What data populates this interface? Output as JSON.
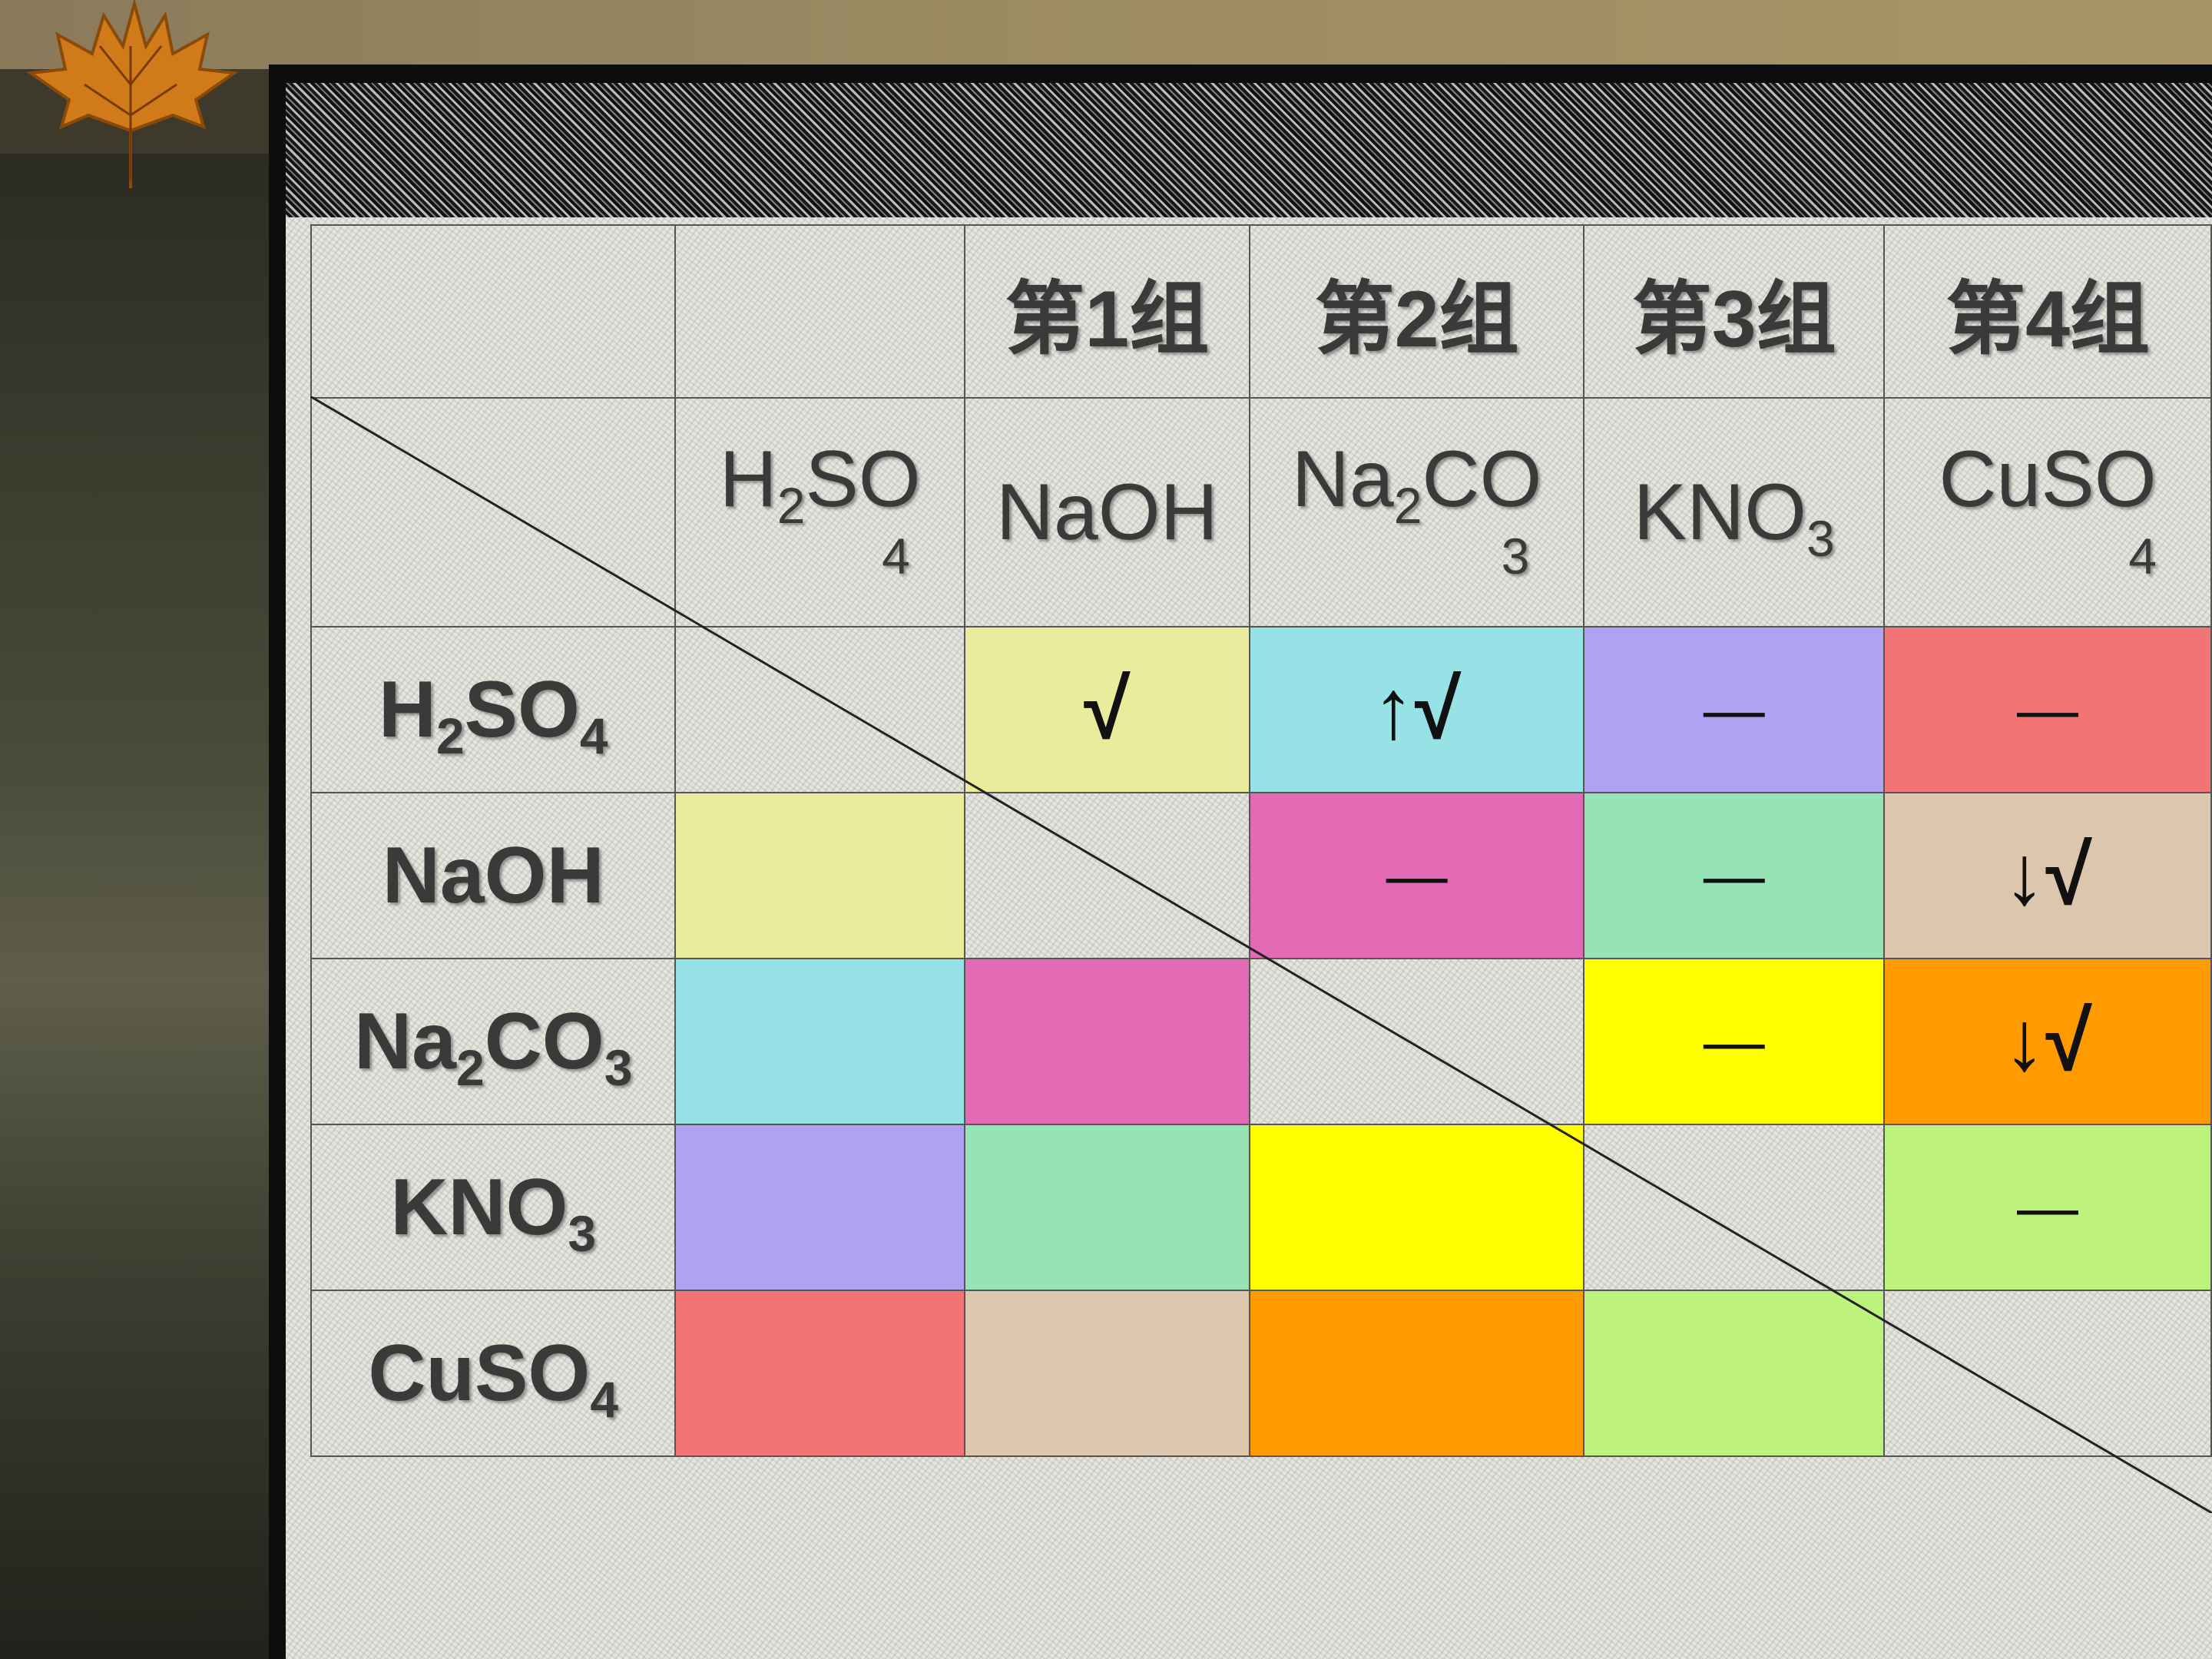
{
  "table": {
    "groups": [
      "",
      "",
      "第1组",
      "第2组",
      "第3组",
      "第4组"
    ],
    "column_formulas": [
      {
        "main": "H",
        "sub": "2",
        "rest": "SO",
        "wrap": "4"
      },
      {
        "main": "NaOH",
        "sub": "",
        "rest": "",
        "wrap": ""
      },
      {
        "main": "Na",
        "sub": "2",
        "rest": "CO",
        "wrap": "3"
      },
      {
        "main": "KNO",
        "sub": "3",
        "rest": "",
        "wrap": ""
      },
      {
        "main": "CuSO",
        "sub": "",
        "rest": "",
        "wrap": "4"
      }
    ],
    "rows": [
      {
        "label": {
          "pre": "H",
          "sub1": "2",
          "mid": "SO",
          "sub2": "4"
        },
        "cells": [
          {
            "color": "",
            "mark": ""
          },
          {
            "color": "#e8ec9c",
            "mark": "√"
          },
          {
            "color": "#96e2e6",
            "mark": "↑√"
          },
          {
            "color": "#b0a2f2",
            "mark": "—"
          },
          {
            "color": "#f27474",
            "mark": "—"
          }
        ]
      },
      {
        "label": {
          "pre": "NaOH",
          "sub1": "",
          "mid": "",
          "sub2": ""
        },
        "cells": [
          {
            "color": "#e8ec9c",
            "mark": ""
          },
          {
            "color": "",
            "mark": ""
          },
          {
            "color": "#e469b4",
            "mark": "—"
          },
          {
            "color": "#96e4b6",
            "mark": "—"
          },
          {
            "color": "#dcc6ae",
            "mark": "↓√"
          }
        ]
      },
      {
        "label": {
          "pre": "Na",
          "sub1": "2",
          "mid": "CO",
          "sub2": "3"
        },
        "cells": [
          {
            "color": "#96e2e6",
            "mark": ""
          },
          {
            "color": "#e469b4",
            "mark": ""
          },
          {
            "color": "",
            "mark": ""
          },
          {
            "color": "#ffff00",
            "mark": "—"
          },
          {
            "color": "#ff9a00",
            "mark": "↓√"
          }
        ]
      },
      {
        "label": {
          "pre": "KNO",
          "sub1": "3",
          "mid": "",
          "sub2": ""
        },
        "cells": [
          {
            "color": "#b0a2f2",
            "mark": ""
          },
          {
            "color": "#96e4b6",
            "mark": ""
          },
          {
            "color": "#ffff00",
            "mark": ""
          },
          {
            "color": "",
            "mark": ""
          },
          {
            "color": "#bdf27c",
            "mark": "—"
          }
        ]
      },
      {
        "label": {
          "pre": "CuSO",
          "sub1": "4",
          "mid": "",
          "sub2": ""
        },
        "cells": [
          {
            "color": "#f27474",
            "mark": ""
          },
          {
            "color": "#dcc6ae",
            "mark": ""
          },
          {
            "color": "#ff9a00",
            "mark": ""
          },
          {
            "color": "#bdf27c",
            "mark": ""
          },
          {
            "color": "",
            "mark": ""
          }
        ]
      }
    ]
  }
}
